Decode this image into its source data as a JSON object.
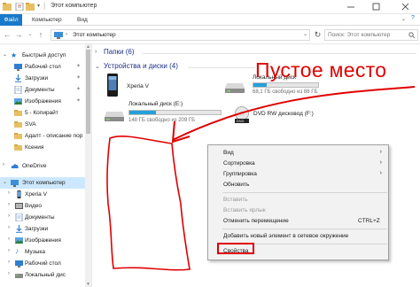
{
  "window": {
    "title": "Этот компьютер"
  },
  "ribbon": {
    "tabs": [
      "Файл",
      "Компьютер",
      "Вид"
    ]
  },
  "address": {
    "crumb": "Этот компьютер",
    "search_placeholder": "Поиск: Этот компьютер"
  },
  "sidebar": {
    "items": [
      {
        "label": "Быстрый доступ",
        "icon": "star-icon"
      },
      {
        "label": "Рабочий стол",
        "icon": "desktop-icon"
      },
      {
        "label": "Загрузки",
        "icon": "download-icon"
      },
      {
        "label": "Документы",
        "icon": "documents-icon"
      },
      {
        "label": "Изображения",
        "icon": "pictures-icon"
      },
      {
        "label": "5 - Копирайт",
        "icon": "folder-icon"
      },
      {
        "label": "SVA",
        "icon": "folder-icon"
      },
      {
        "label": "Адалт - описание пор",
        "icon": "folder-icon"
      },
      {
        "label": "Ксения",
        "icon": "folder-icon"
      },
      {
        "label": "OneDrive",
        "icon": "cloud-icon"
      },
      {
        "label": "Этот компьютер",
        "icon": "computer-icon"
      },
      {
        "label": "Xperia V",
        "icon": "phone-icon"
      },
      {
        "label": "Видео",
        "icon": "video-icon"
      },
      {
        "label": "Документы",
        "icon": "documents-icon"
      },
      {
        "label": "Загрузки",
        "icon": "download-icon"
      },
      {
        "label": "Изображения",
        "icon": "pictures-icon"
      },
      {
        "label": "Музыка",
        "icon": "music-icon"
      },
      {
        "label": "Рабочий стол",
        "icon": "desktop-icon"
      },
      {
        "label": "Локальный дис",
        "icon": "drive-icon"
      }
    ]
  },
  "content": {
    "folders_header": "Папки (6)",
    "devices_header": "Устройства и диски (4)",
    "devices": [
      {
        "name": "Xperia V",
        "free": ""
      },
      {
        "name": "Локальный диск (E:)",
        "free": "148 ГБ свободно из 209 ГБ",
        "used_fraction": 0.29
      },
      {
        "name": "Локальный диск",
        "free": "68,1 ГБ свободно из 86 ГБ",
        "used_fraction": 0.21
      },
      {
        "name": "DVD RW дисковод (F:)",
        "free": ""
      }
    ]
  },
  "annotation": {
    "text": "Пустое место",
    "color": "#e00000"
  },
  "context_menu": {
    "view": "Вид",
    "sort": "Сортировка",
    "group": "Группировка",
    "refresh": "Обновить",
    "paste": "Вставить",
    "paste_shortcut": "Вставить ярлык",
    "undo_move": "Отменить перемещение",
    "undo_shortcut": "CTRL+Z",
    "add_network": "Добавить новый элемент в сетевое окружение",
    "properties": "Свойства"
  },
  "colors": {
    "accent": "#1979ca",
    "selection": "#cce8ff",
    "drive_bar": "#26a0da",
    "header_text": "#1e3287"
  }
}
